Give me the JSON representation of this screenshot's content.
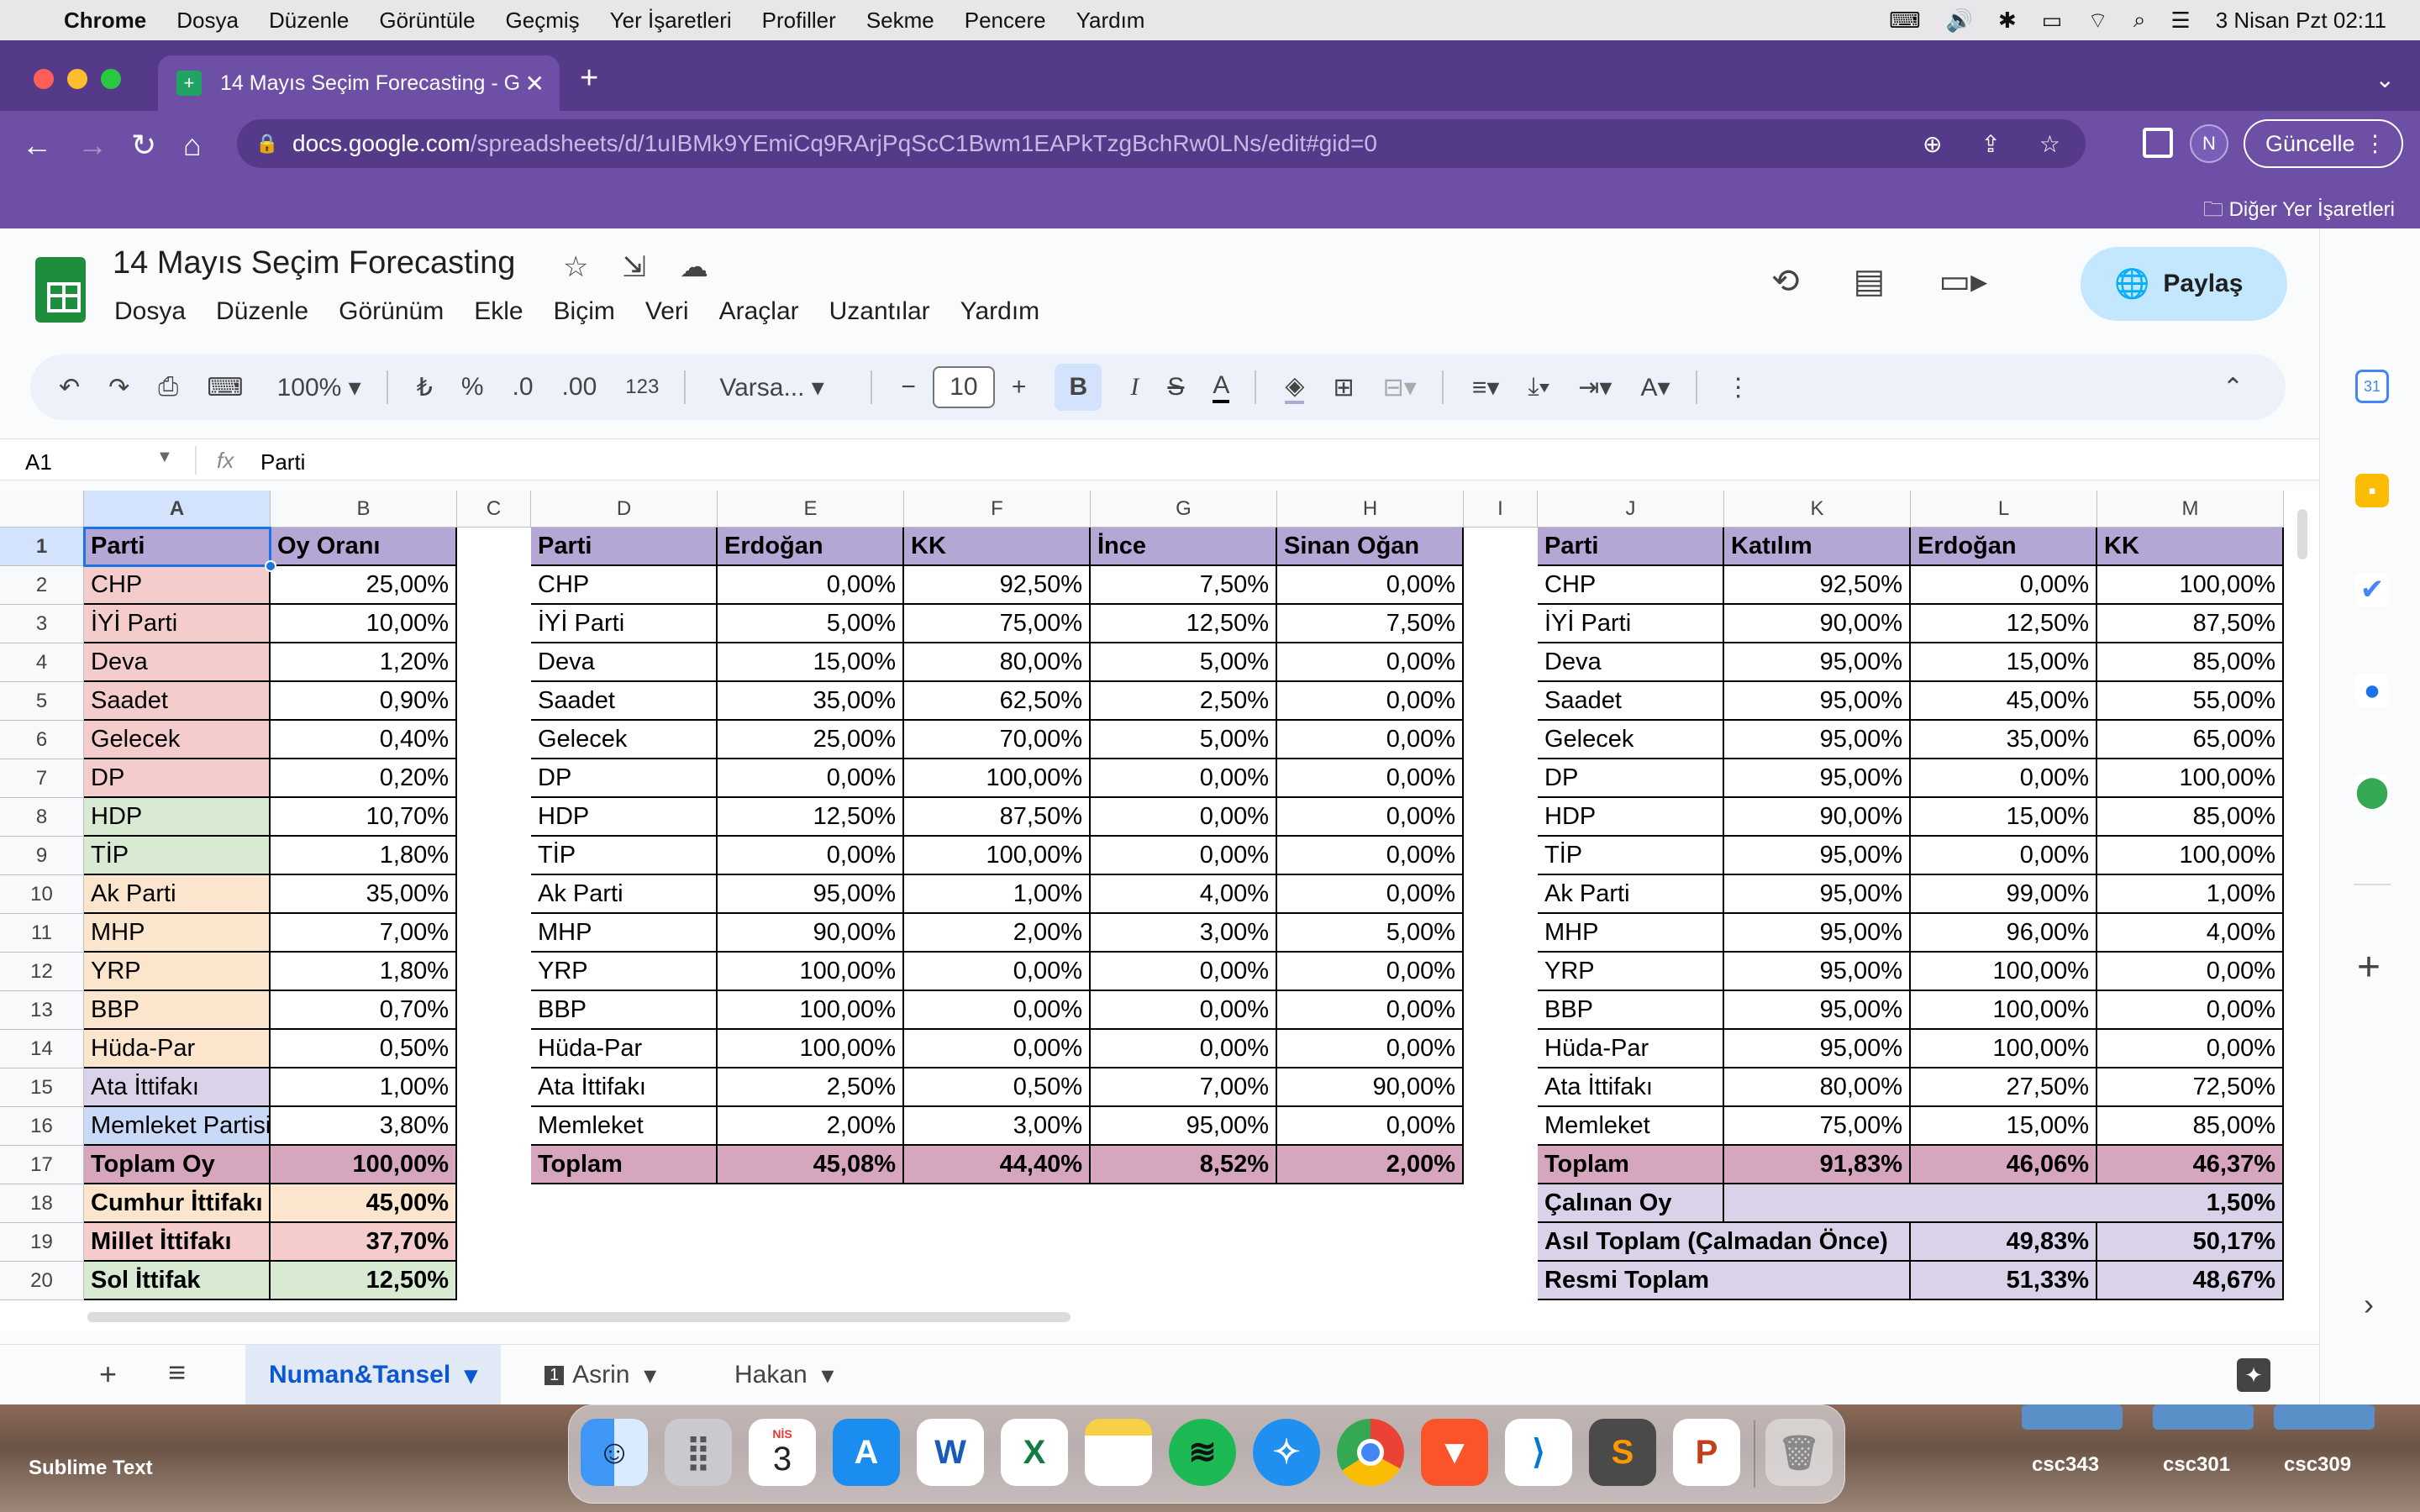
{
  "mac_menu": {
    "app": "Chrome",
    "items": [
      "Dosya",
      "Düzenle",
      "Görüntüle",
      "Geçmiş",
      "Yer İşaretleri",
      "Profiller",
      "Sekme",
      "Pencere",
      "Yardım"
    ],
    "datetime": "3 Nisan Pzt  02:11"
  },
  "browser": {
    "tab_title": "14 Mayıs Seçim Forecasting - G",
    "url_host": "docs.google.com",
    "url_path": "/spreadsheets/d/1uIBMk9YEmiCq9RArjPqScC1Bwm1EAPkTzgBchRw0LNs/edit#gid=0",
    "profile_initial": "N",
    "update_label": "Güncelle",
    "bookmarks_other": "Diğer Yer İşaretleri"
  },
  "sheets": {
    "doc_title": "14 Mayıs Seçim Forecasting",
    "menu": [
      "Dosya",
      "Düzenle",
      "Görünüm",
      "Ekle",
      "Biçim",
      "Veri",
      "Araçlar",
      "Uzantılar",
      "Yardım"
    ],
    "share_label": "Paylaş",
    "user_initial": "N",
    "zoom": "100%",
    "currency": "₺",
    "percent": "%",
    "dec_minus": ".0",
    "dec_plus": ".00",
    "num_format": "123",
    "font": "Varsa...",
    "font_size": "10",
    "cell_ref": "A1",
    "formula_value": "Parti"
  },
  "grid": {
    "columns": [
      "A",
      "B",
      "C",
      "D",
      "E",
      "F",
      "G",
      "H",
      "I",
      "J",
      "K",
      "L",
      "M"
    ],
    "rows": [
      "1",
      "2",
      "3",
      "4",
      "5",
      "6",
      "7",
      "8",
      "9",
      "10",
      "11",
      "12",
      "13",
      "14",
      "15",
      "16",
      "17",
      "18",
      "19",
      "20"
    ],
    "table1": {
      "header": [
        "Parti",
        "Oy Oranı"
      ],
      "rows": [
        [
          "CHP",
          "25,00%"
        ],
        [
          "İYİ Parti",
          "10,00%"
        ],
        [
          "Deva",
          "1,20%"
        ],
        [
          "Saadet",
          "0,90%"
        ],
        [
          "Gelecek",
          "0,40%"
        ],
        [
          "DP",
          "0,20%"
        ],
        [
          "HDP",
          "10,70%"
        ],
        [
          "TİP",
          "1,80%"
        ],
        [
          "Ak Parti",
          "35,00%"
        ],
        [
          "MHP",
          "7,00%"
        ],
        [
          "YRP",
          "1,80%"
        ],
        [
          "BBP",
          "0,70%"
        ],
        [
          "Hüda-Par",
          "0,50%"
        ],
        [
          "Ata İttifakı",
          "1,00%"
        ],
        [
          "Memleket Partisi",
          "3,80%"
        ]
      ],
      "totals": [
        [
          "Toplam Oy",
          "100,00%"
        ],
        [
          "Cumhur İttifakı",
          "45,00%"
        ],
        [
          "Millet İttifakı",
          "37,70%"
        ],
        [
          "Sol İttifak",
          "12,50%"
        ]
      ],
      "colors": {
        "millet": "#f4cccc",
        "sol": "#d9ead3",
        "cumhur": "#fce5cd",
        "ata": "#d9d2e9",
        "memleket": "#c9daf8",
        "header": "#b4a7d6",
        "total": "#d5a6bd"
      }
    },
    "table2": {
      "header": [
        "Parti",
        "Erdoğan",
        "KK",
        "İnce",
        "Sinan Oğan"
      ],
      "rows": [
        [
          "CHP",
          "0,00%",
          "92,50%",
          "7,50%",
          "0,00%"
        ],
        [
          "İYİ Parti",
          "5,00%",
          "75,00%",
          "12,50%",
          "7,50%"
        ],
        [
          "Deva",
          "15,00%",
          "80,00%",
          "5,00%",
          "0,00%"
        ],
        [
          "Saadet",
          "35,00%",
          "62,50%",
          "2,50%",
          "0,00%"
        ],
        [
          "Gelecek",
          "25,00%",
          "70,00%",
          "5,00%",
          "0,00%"
        ],
        [
          "DP",
          "0,00%",
          "100,00%",
          "0,00%",
          "0,00%"
        ],
        [
          "HDP",
          "12,50%",
          "87,50%",
          "0,00%",
          "0,00%"
        ],
        [
          "TİP",
          "0,00%",
          "100,00%",
          "0,00%",
          "0,00%"
        ],
        [
          "Ak Parti",
          "95,00%",
          "1,00%",
          "4,00%",
          "0,00%"
        ],
        [
          "MHP",
          "90,00%",
          "2,00%",
          "3,00%",
          "5,00%"
        ],
        [
          "YRP",
          "100,00%",
          "0,00%",
          "0,00%",
          "0,00%"
        ],
        [
          "BBP",
          "100,00%",
          "0,00%",
          "0,00%",
          "0,00%"
        ],
        [
          "Hüda-Par",
          "100,00%",
          "0,00%",
          "0,00%",
          "0,00%"
        ],
        [
          "Ata İttifakı",
          "2,50%",
          "0,50%",
          "7,00%",
          "90,00%"
        ],
        [
          "Memleket",
          "2,00%",
          "3,00%",
          "95,00%",
          "0,00%"
        ]
      ],
      "total": [
        "Toplam",
        "45,08%",
        "44,40%",
        "8,52%",
        "2,00%"
      ]
    },
    "table3": {
      "header": [
        "Parti",
        "Katılım",
        "Erdoğan",
        "KK"
      ],
      "rows": [
        [
          "CHP",
          "92,50%",
          "0,00%",
          "100,00%"
        ],
        [
          "İYİ Parti",
          "90,00%",
          "12,50%",
          "87,50%"
        ],
        [
          "Deva",
          "95,00%",
          "15,00%",
          "85,00%"
        ],
        [
          "Saadet",
          "95,00%",
          "45,00%",
          "55,00%"
        ],
        [
          "Gelecek",
          "95,00%",
          "35,00%",
          "65,00%"
        ],
        [
          "DP",
          "95,00%",
          "0,00%",
          "100,00%"
        ],
        [
          "HDP",
          "90,00%",
          "15,00%",
          "85,00%"
        ],
        [
          "TİP",
          "95,00%",
          "0,00%",
          "100,00%"
        ],
        [
          "Ak Parti",
          "95,00%",
          "99,00%",
          "1,00%"
        ],
        [
          "MHP",
          "95,00%",
          "96,00%",
          "4,00%"
        ],
        [
          "YRP",
          "95,00%",
          "100,00%",
          "0,00%"
        ],
        [
          "BBP",
          "95,00%",
          "100,00%",
          "0,00%"
        ],
        [
          "Hüda-Par",
          "95,00%",
          "100,00%",
          "0,00%"
        ],
        [
          "Ata İttifakı",
          "80,00%",
          "27,50%",
          "72,50%"
        ],
        [
          "Memleket",
          "75,00%",
          "15,00%",
          "85,00%"
        ]
      ],
      "total": [
        "Toplam",
        "91,83%",
        "46,06%",
        "46,37%"
      ],
      "stolen": [
        "Çalınan Oy",
        "1,50%"
      ],
      "real_total": [
        "Asıl Toplam (Çalmadan Önce)",
        "49,83%",
        "50,17%"
      ],
      "official_total": [
        "Resmi Toplam",
        "51,33%",
        "48,67%"
      ]
    }
  },
  "sheet_tabs": [
    "Numan&Tansel",
    "Asrin",
    "Hakan"
  ],
  "sheet_tab_badge": "1",
  "dock": {
    "left_label": "Sublime Text",
    "right_labels": [
      "csc343",
      "csc301",
      "csc309"
    ],
    "calendar_month": "NİS",
    "calendar_day": "3"
  }
}
